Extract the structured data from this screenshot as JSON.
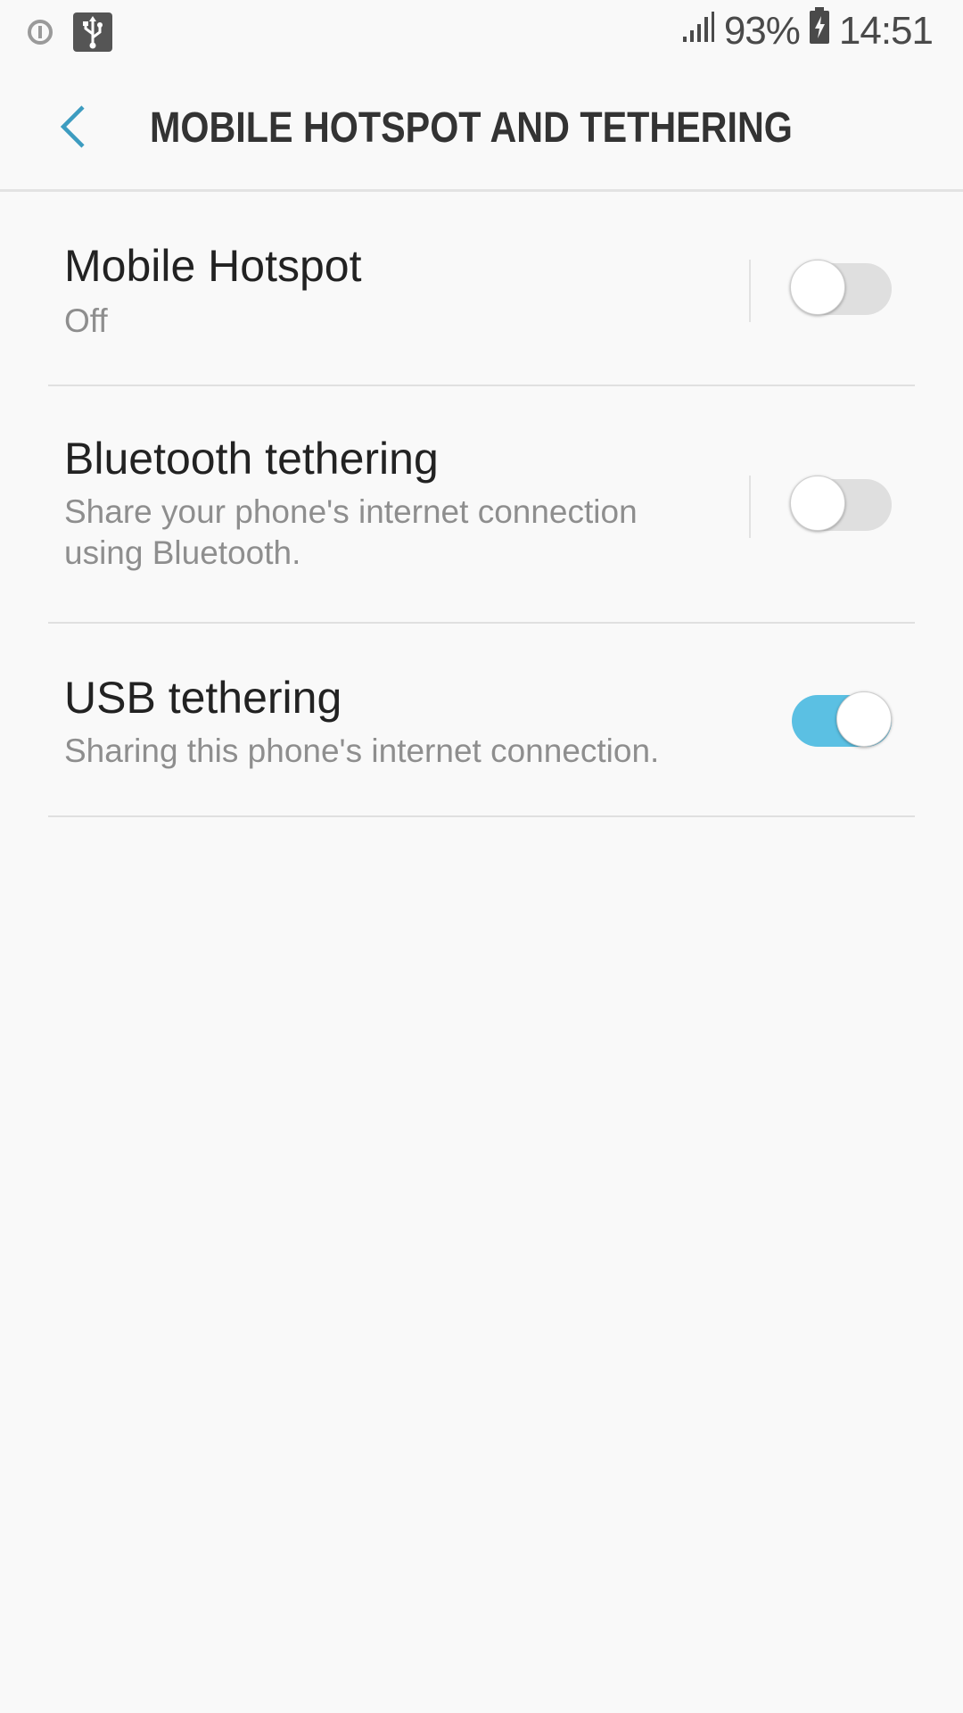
{
  "status_bar": {
    "left_icons": [
      "alert-circle-icon",
      "usb-icon"
    ],
    "signal_icon": "signal-bars-icon",
    "battery_percent": "93%",
    "battery_icon": "battery-charging-icon",
    "time": "14:51"
  },
  "header": {
    "back_icon": "chevron-left-icon",
    "title": "MOBILE HOTSPOT AND TETHERING"
  },
  "settings": [
    {
      "title": "Mobile Hotspot",
      "subtitle": "Off",
      "enabled": false
    },
    {
      "title": "Bluetooth tethering",
      "subtitle": "Share your phone's internet connection using Bluetooth.",
      "enabled": false
    },
    {
      "title": "USB tethering",
      "subtitle": "Sharing this phone's internet connection.",
      "enabled": true
    }
  ],
  "colors": {
    "accent": "#5bc0e3",
    "back_arrow": "#3d9cc0",
    "toggle_off": "#dfdfdf",
    "background": "#f9f9f9"
  }
}
